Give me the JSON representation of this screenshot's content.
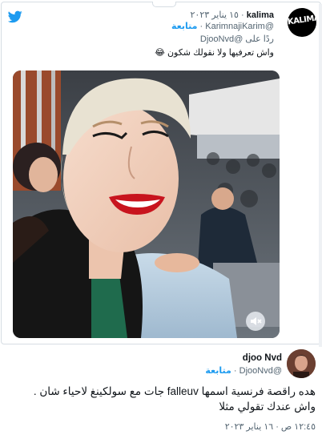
{
  "quoted_tweet": {
    "author_name": "kalima",
    "handle": "@KarimnajiKarim",
    "date": "١٥ يناير ٢٠٢٣",
    "separator": "·",
    "follow_label": "متابعة",
    "reply_prefix": "ردًا على",
    "reply_handle": "@DjooNvd",
    "text": "واش تعرفيها ولا نقولك شكون 😂",
    "avatar_logo_text": "KALIMA"
  },
  "main_tweet": {
    "author_name": "djoo Nvd",
    "handle": "@DjooNvd",
    "follow_label": "متابعة",
    "text": "هده راقصة فرنسية اسمها falleuv جات مع سولكينغ لاحياء شان . واش عندك تقولي مثلا",
    "timestamp": "١٢:٤٥ ص · ١٦ يناير ٢٠٢٣"
  },
  "icons": {
    "brand": "twitter-bird-icon",
    "media_control": "speaker-mute-icon"
  },
  "colors": {
    "accent": "#1d9bf0",
    "muted": "#536471",
    "border": "#d6dde3",
    "lipstick": "#c8141e"
  }
}
